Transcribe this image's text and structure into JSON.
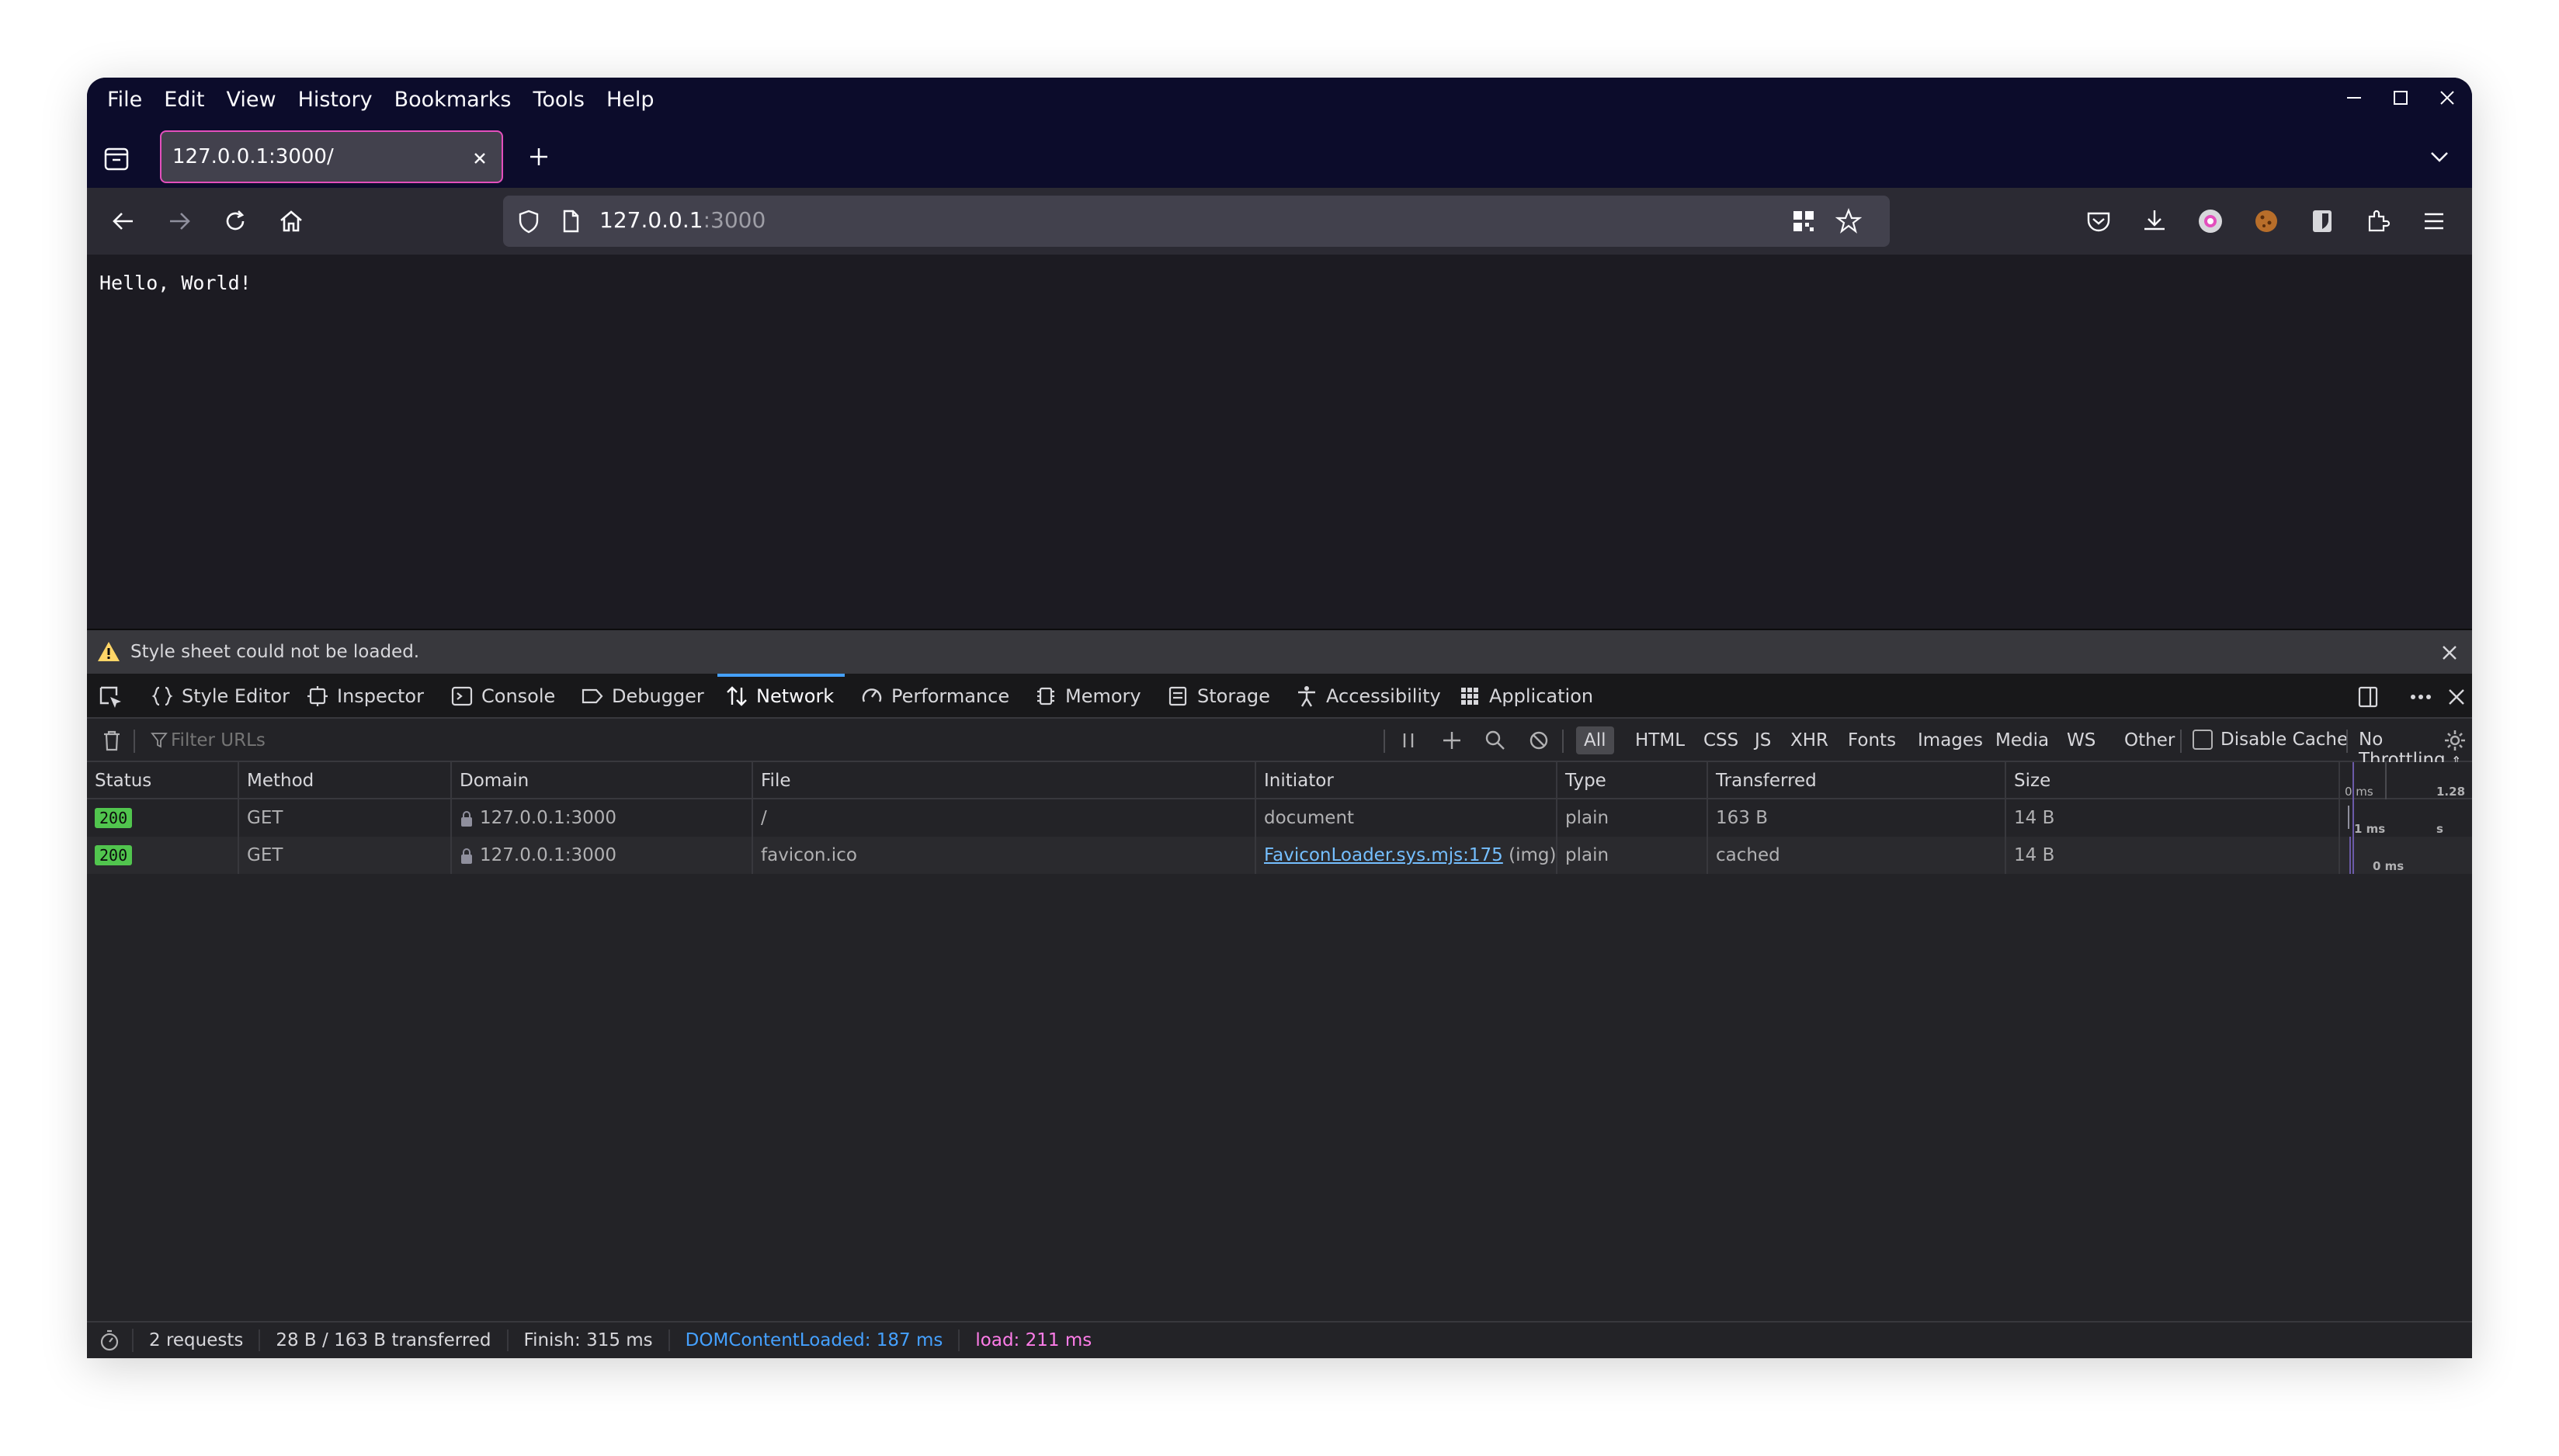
{
  "menu": [
    "File",
    "Edit",
    "View",
    "History",
    "Bookmarks",
    "Tools",
    "Help"
  ],
  "tab": {
    "title": "127.0.0.1:3000/"
  },
  "urlbar": {
    "host": "127.0.0.1",
    "port": ":3000"
  },
  "page": {
    "text": "Hello, World!"
  },
  "notification": {
    "text": "Style sheet could not be loaded."
  },
  "toolbox": {
    "tabs": [
      {
        "label": "Style Editor",
        "icon": "braces-icon"
      },
      {
        "label": "Inspector",
        "icon": "inspector-icon"
      },
      {
        "label": "Console",
        "icon": "console-icon"
      },
      {
        "label": "Debugger",
        "icon": "debugger-icon"
      },
      {
        "label": "Network",
        "icon": "network-icon",
        "selected": true
      },
      {
        "label": "Performance",
        "icon": "performance-icon"
      },
      {
        "label": "Memory",
        "icon": "memory-icon"
      },
      {
        "label": "Storage",
        "icon": "storage-icon"
      },
      {
        "label": "Accessibility",
        "icon": "accessibility-icon"
      },
      {
        "label": "Application",
        "icon": "application-icon"
      }
    ]
  },
  "network": {
    "filter_placeholder": "Filter URLs",
    "type_filters": [
      "All",
      "HTML",
      "CSS",
      "JS",
      "XHR",
      "Fonts",
      "Images",
      "Media",
      "WS",
      "Other"
    ],
    "selected_filter": "All",
    "disable_cache_label": "Disable Cache",
    "throttling": "No Throttling",
    "columns": [
      "Status",
      "Method",
      "Domain",
      "File",
      "Initiator",
      "Type",
      "Transferred",
      "Size"
    ],
    "waterfall_ticks": [
      "0 ms",
      "1.28 s"
    ],
    "rows": [
      {
        "status": "200",
        "method": "GET",
        "domain": "127.0.0.1:3000",
        "file": "/",
        "initiator": "document",
        "initiator_extra": "",
        "type": "plain",
        "transferred": "163 B",
        "size": "14 B",
        "timing": "1 ms"
      },
      {
        "status": "200",
        "method": "GET",
        "domain": "127.0.0.1:3000",
        "file": "favicon.ico",
        "initiator": "FaviconLoader.sys.mjs:175",
        "initiator_extra": "(img)",
        "type": "plain",
        "transferred": "cached",
        "size": "14 B",
        "timing": "0 ms"
      }
    ]
  },
  "statusbar": {
    "requests": "2 requests",
    "transferred": "28 B / 163 B transferred",
    "finish": "Finish: 315 ms",
    "dcl": "DOMContentLoaded: 187 ms",
    "load": "load: 211 ms"
  },
  "colors": {
    "tab_border": "#e34fbd",
    "selected_tab": "#45a1ff",
    "status_ok": "#51c54e",
    "dcl": "#45a1ff",
    "load": "#ff7de9"
  }
}
